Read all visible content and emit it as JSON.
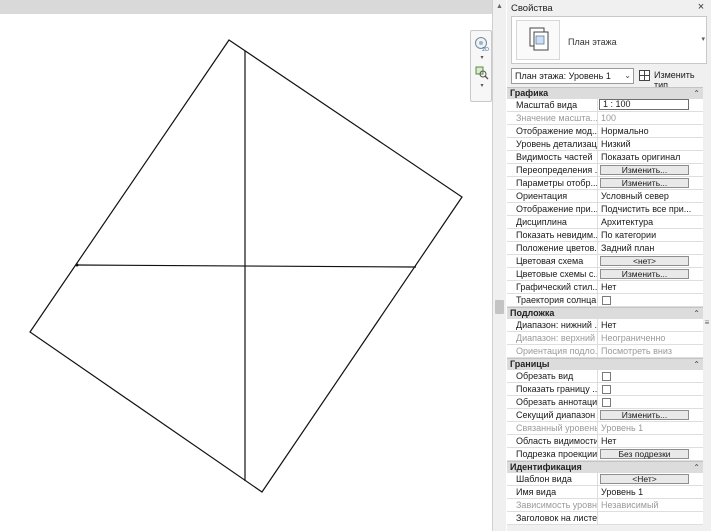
{
  "panel": {
    "title": "Свойства",
    "type_selector": {
      "type_name": "План этажа"
    },
    "instance": {
      "selected": "План этажа: Уровень 1",
      "edit_type_label": "Изменить тип"
    }
  },
  "sections": [
    {
      "title": "Графика",
      "rows": [
        {
          "name": "Масштаб вида",
          "value": "1 : 100",
          "kind": "field"
        },
        {
          "name": "Значение масшта...",
          "value": "100",
          "kind": "text",
          "disabled": true
        },
        {
          "name": "Отображение мод...",
          "value": "Нормально",
          "kind": "text"
        },
        {
          "name": "Уровень детализац...",
          "value": "Низкий",
          "kind": "text"
        },
        {
          "name": "Видимость частей",
          "value": "Показать оригинал",
          "kind": "text"
        },
        {
          "name": "Переопределения ...",
          "value": "Изменить...",
          "kind": "button"
        },
        {
          "name": "Параметры отобр...",
          "value": "Изменить...",
          "kind": "button"
        },
        {
          "name": "Ориентация",
          "value": "Условный север",
          "kind": "text"
        },
        {
          "name": "Отображение при...",
          "value": "Подчистить все при...",
          "kind": "text"
        },
        {
          "name": "Дисциплина",
          "value": "Архитектура",
          "kind": "text"
        },
        {
          "name": "Показать невидим...",
          "value": "По категории",
          "kind": "text"
        },
        {
          "name": "Положение цветов...",
          "value": "Задний план",
          "kind": "text"
        },
        {
          "name": "Цветовая схема",
          "value": "<нет>",
          "kind": "button"
        },
        {
          "name": "Цветовые схемы с...",
          "value": "Изменить...",
          "kind": "button"
        },
        {
          "name": "Графический стил...",
          "value": "Нет",
          "kind": "text"
        },
        {
          "name": "Траектория солнца",
          "value": "",
          "kind": "checkbox"
        }
      ]
    },
    {
      "title": "Подложка",
      "rows": [
        {
          "name": "Диапазон: нижний ...",
          "value": "Нет",
          "kind": "text"
        },
        {
          "name": "Диапазон: верхний ...",
          "value": "Неограниченно",
          "kind": "text",
          "disabled": true
        },
        {
          "name": "Ориентация подло...",
          "value": "Посмотреть вниз",
          "kind": "text",
          "disabled": true
        }
      ]
    },
    {
      "title": "Границы",
      "rows": [
        {
          "name": "Обрезать вид",
          "value": "",
          "kind": "checkbox"
        },
        {
          "name": "Показать границу ...",
          "value": "",
          "kind": "checkbox"
        },
        {
          "name": "Обрезать аннотации",
          "value": "",
          "kind": "checkbox"
        },
        {
          "name": "Секущий диапазон",
          "value": "Изменить...",
          "kind": "button"
        },
        {
          "name": "Связанный уровень",
          "value": "Уровень 1",
          "kind": "text",
          "disabled": true
        },
        {
          "name": "Область видимости",
          "value": "Нет",
          "kind": "text"
        },
        {
          "name": "Подрезка проекции",
          "value": "Без подрезки",
          "kind": "button"
        }
      ]
    },
    {
      "title": "Идентификация",
      "rows": [
        {
          "name": "Шаблон вида",
          "value": "<Нет>",
          "kind": "button"
        },
        {
          "name": "Имя вида",
          "value": "Уровень 1",
          "kind": "text"
        },
        {
          "name": "Зависимость уровня",
          "value": "Независимый",
          "kind": "text",
          "disabled": true
        },
        {
          "name": "Заголовок на листе",
          "value": "",
          "kind": "text"
        }
      ]
    }
  ],
  "icons": {
    "close": "close-icon",
    "collapse": "chevron-up-icon",
    "nav_wheel": "steering-wheel-icon",
    "zoom": "zoom-region-icon"
  },
  "colors": {
    "canvas": "#ffffff",
    "panel": "#f0f0f0",
    "section": "#dcdcdc",
    "disabled_text": "#9a9a9a"
  }
}
